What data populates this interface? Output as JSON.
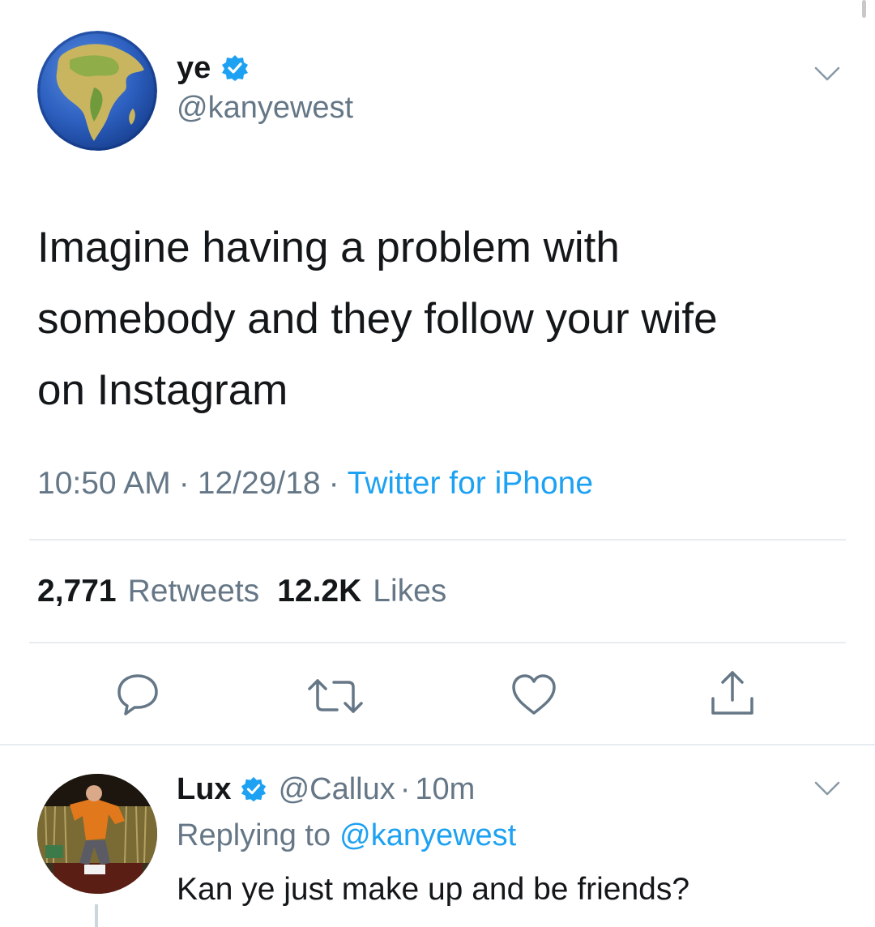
{
  "tweet": {
    "display_name": "ye",
    "handle": "@kanyewest",
    "avatar_icon": "earth-globe-africa-icon",
    "verified_icon": "verified-badge-icon",
    "menu_icon": "chevron-down-icon",
    "text_lines": [
      "Imagine having a problem with",
      "somebody and they follow your wife",
      "on Instagram"
    ],
    "time": "10:50 AM",
    "date": "12/29/18",
    "separator": "·",
    "source": "Twitter for iPhone",
    "retweet_count": "2,771",
    "retweet_label": "Retweets",
    "like_count": "12.2K",
    "like_label": "Likes",
    "actions": [
      "reply-icon",
      "retweet-icon",
      "like-icon",
      "share-icon"
    ]
  },
  "reply": {
    "display_name": "Lux",
    "handle": "@Callux",
    "separator": "·",
    "age": "10m",
    "replying_prefix": "Replying to",
    "replying_handle": "@kanyewest",
    "text": "Kan ye just make up and be friends?",
    "avatar_icon": "user-avatar-photo",
    "menu_icon": "chevron-down-icon"
  },
  "colors": {
    "accent": "#1da1f2",
    "text": "#14171a",
    "muted": "#657786",
    "divider": "#e6ecf0"
  }
}
